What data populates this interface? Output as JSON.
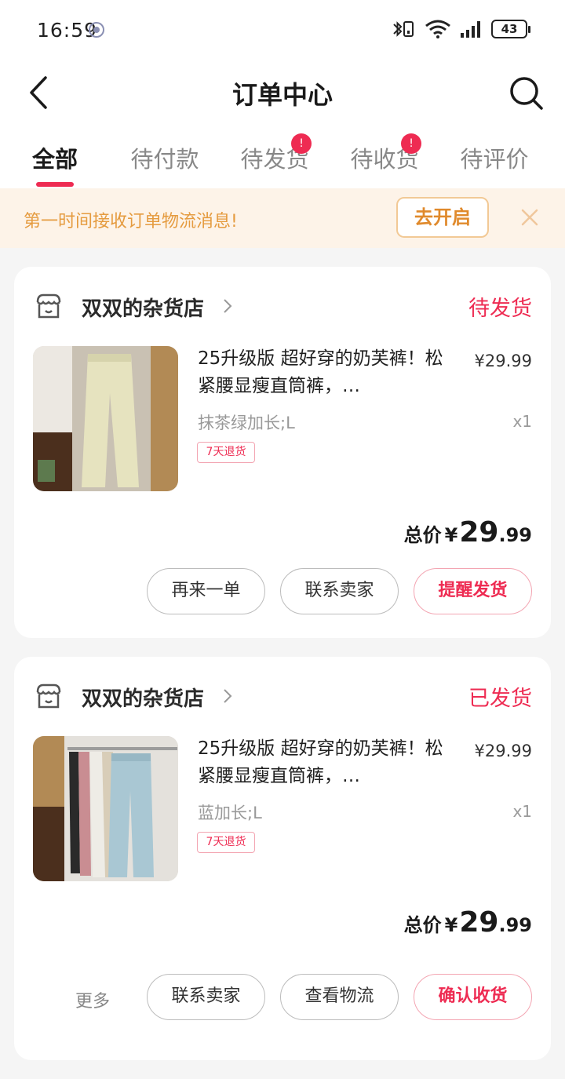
{
  "status_bar": {
    "time": "16:59",
    "battery": "43"
  },
  "nav": {
    "title": "订单中心"
  },
  "tabs": [
    {
      "label": "全部",
      "active": true,
      "badge": ""
    },
    {
      "label": "待付款",
      "active": false,
      "badge": ""
    },
    {
      "label": "待发货",
      "active": false,
      "badge": "!"
    },
    {
      "label": "待收货",
      "active": false,
      "badge": "!"
    },
    {
      "label": "待评价",
      "active": false,
      "badge": ""
    }
  ],
  "banner": {
    "text": "第一时间接收订单物流消息!",
    "button": "去开启"
  },
  "orders": [
    {
      "shop": "双双的杂货店",
      "status": "待发货",
      "title": "25升级版 超好穿的奶芙裤！松紧腰显瘦直筒裤，…",
      "price": "¥29.99",
      "spec": "抹茶绿加长;L",
      "qty": "x1",
      "tag": "7天退货",
      "total_label": "总价",
      "total_currency": "¥",
      "total_int": "29",
      "total_dec": ".99",
      "buttons": [
        "再来一单",
        "联系卖家",
        "提醒发货"
      ]
    },
    {
      "shop": "双双的杂货店",
      "status": "已发货",
      "title": "25升级版 超好穿的奶芙裤！松紧腰显瘦直筒裤，…",
      "price": "¥29.99",
      "spec": "蓝加长;L",
      "qty": "x1",
      "tag": "7天退货",
      "total_label": "总价",
      "total_currency": "¥",
      "total_int": "29",
      "total_dec": ".99",
      "more": "更多",
      "buttons": [
        "联系卖家",
        "查看物流",
        "确认收货"
      ]
    }
  ],
  "colors": {
    "accent": "#ee2b52",
    "banner_bg": "#fdf3e8",
    "banner_text": "#e59b3f"
  }
}
